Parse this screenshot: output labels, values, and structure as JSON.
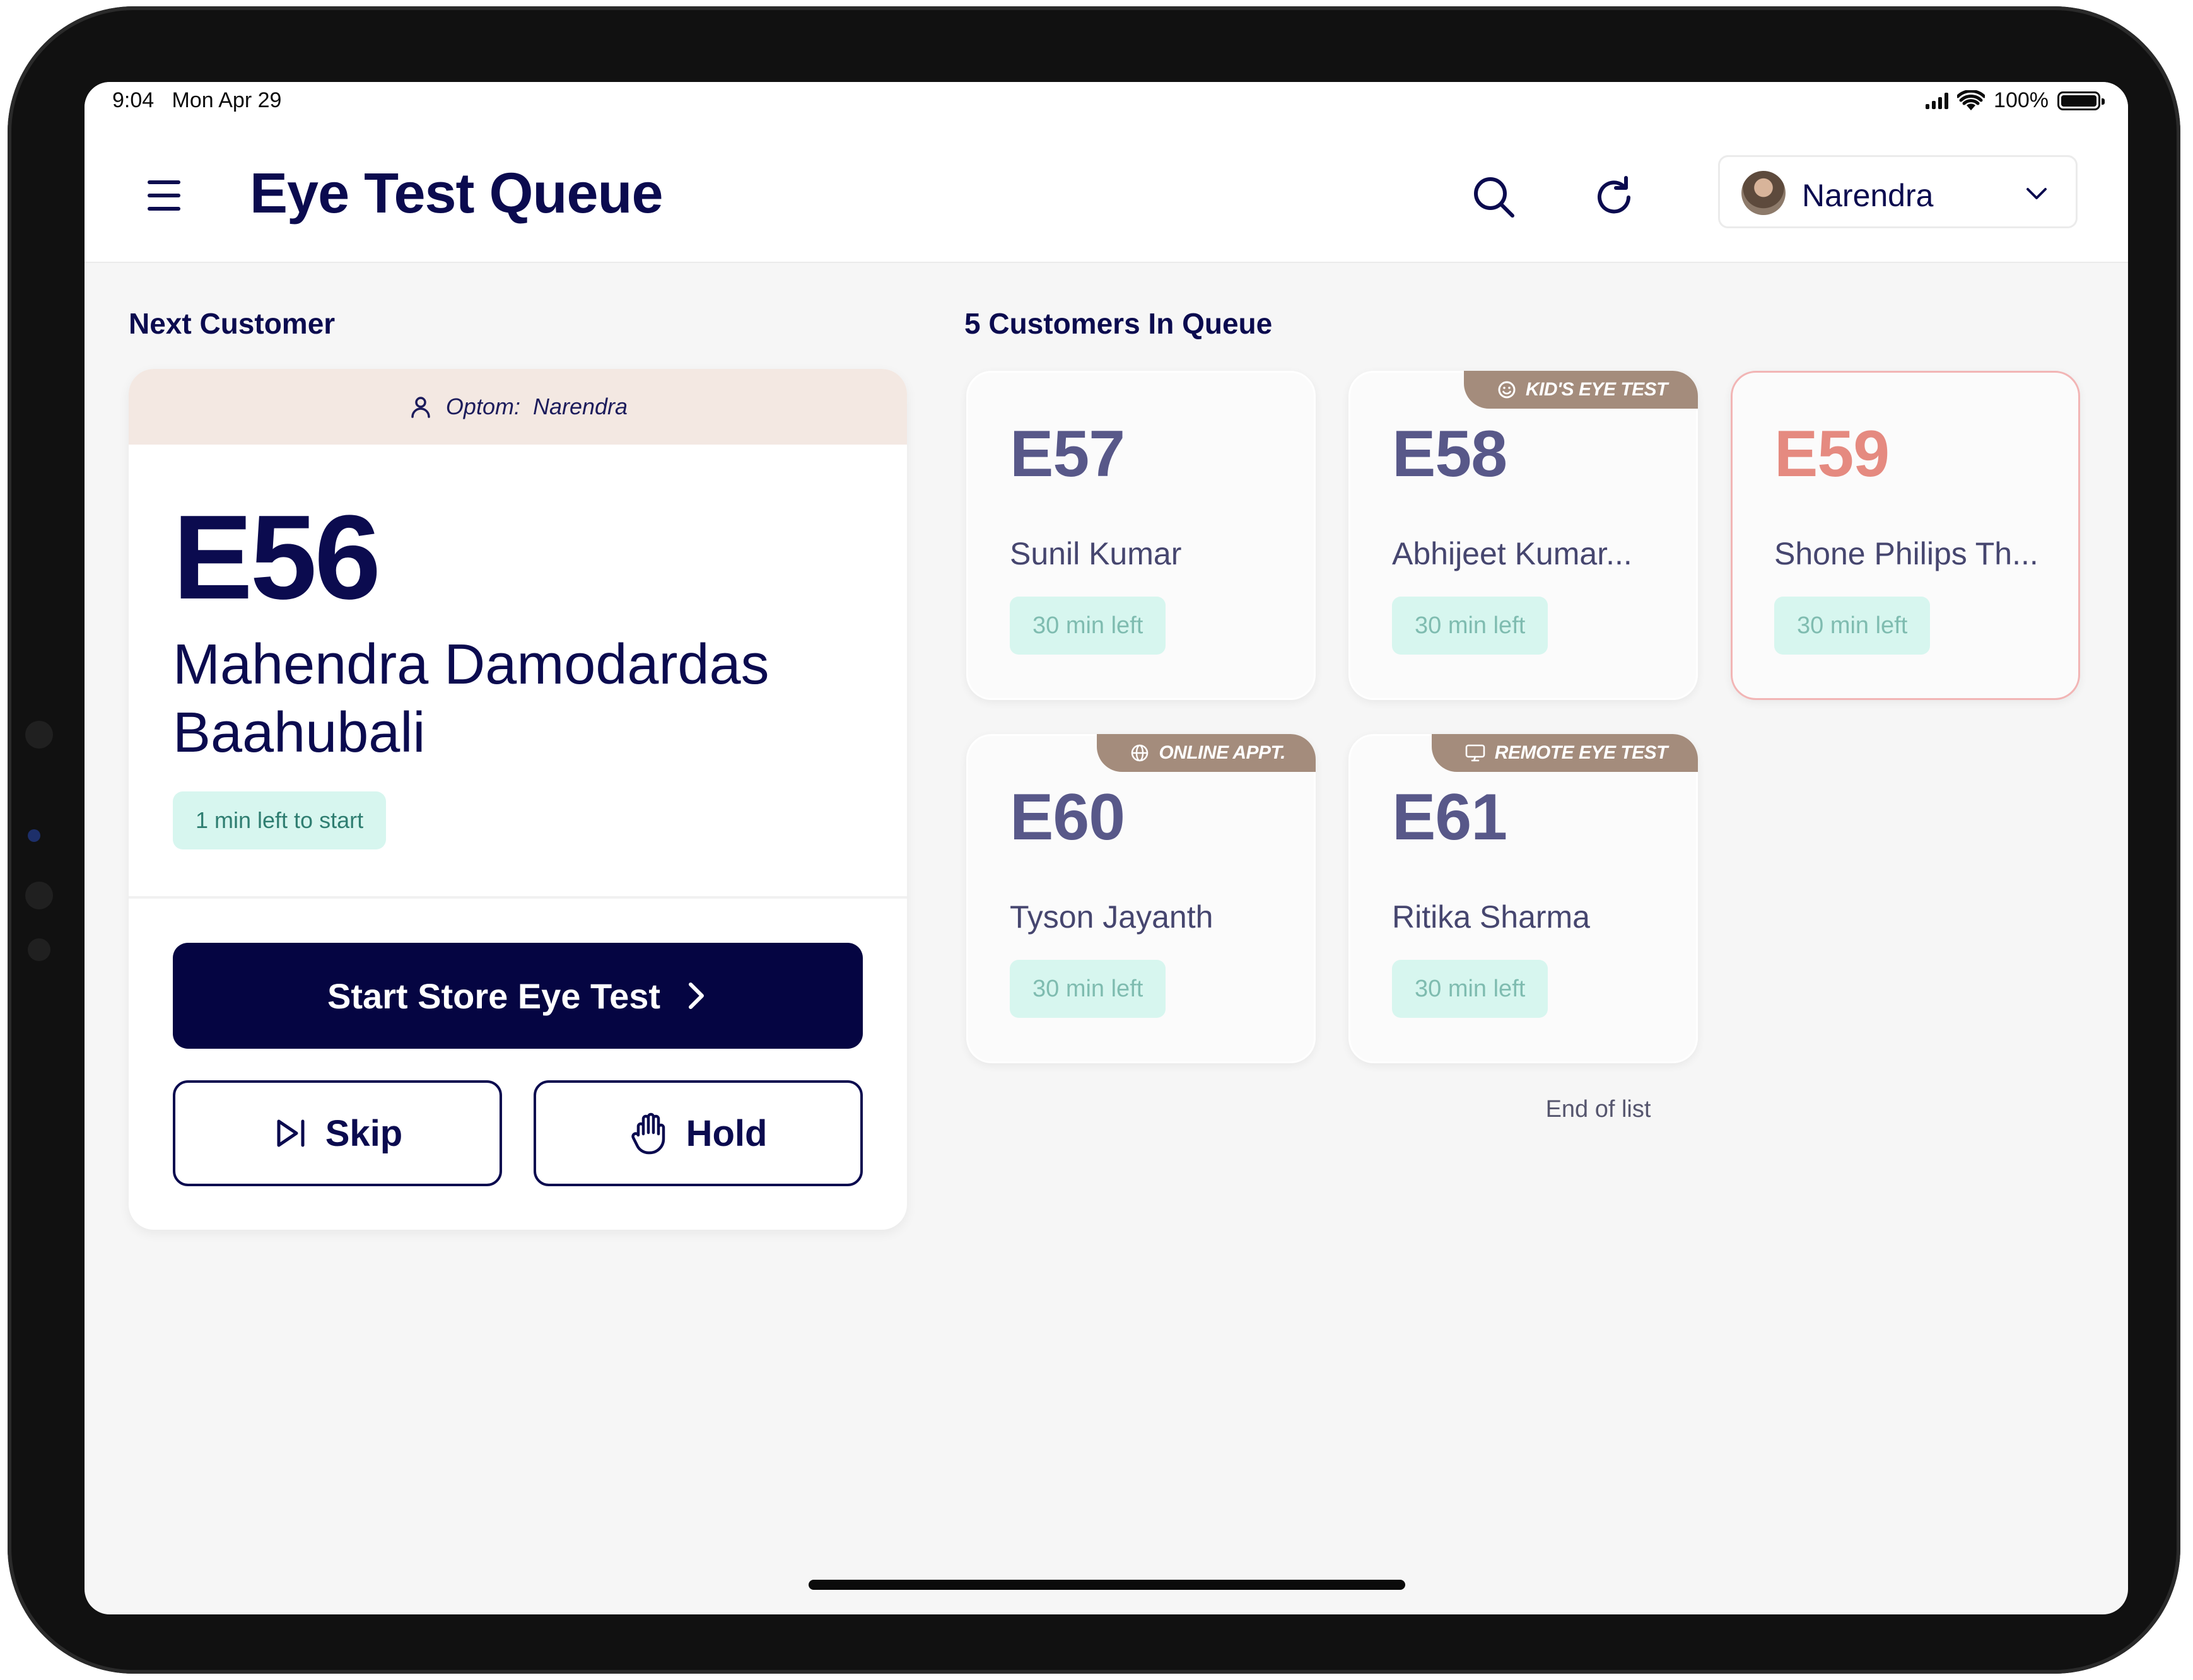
{
  "status_bar": {
    "time": "9:04",
    "date": "Mon Apr 29",
    "battery": "100%"
  },
  "header": {
    "title": "Eye Test Queue",
    "user_name": "Narendra",
    "icons": [
      "menu-icon",
      "search-icon",
      "refresh-icon",
      "chevron-down-icon"
    ]
  },
  "next_customer": {
    "section_title": "Next Customer",
    "optom_label": "Optom:",
    "optom_name": "Narendra",
    "token": "E56",
    "name": "Mahendra Damodardas Baahubali",
    "time_badge": "1 min left to start",
    "start_button": "Start Store Eye Test",
    "skip_button": "Skip",
    "hold_button": "Hold"
  },
  "queue": {
    "section_title": "5 Customers In Queue",
    "end_text": "End of list",
    "items": [
      {
        "token": "E57",
        "name": "Sunil Kumar",
        "time": "30 min left",
        "tag": ""
      },
      {
        "token": "E58",
        "name": "Abhijeet Kumar...",
        "time": "30 min left",
        "tag": "KID'S EYE TEST"
      },
      {
        "token": "E59",
        "name": "Shone Philips Th...",
        "time": "30 min left",
        "tag": ""
      },
      {
        "token": "E60",
        "name": "Tyson Jayanth",
        "time": "30 min left",
        "tag": "ONLINE APPT."
      },
      {
        "token": "E61",
        "name": "Ritika Sharma",
        "time": "30 min left",
        "tag": "REMOTE EYE TEST"
      }
    ]
  },
  "colors": {
    "primary": "#050542",
    "badge_bg": "#d7f6ef",
    "badge_text": "#2f7e71",
    "tag_bg": "#a48c7c",
    "late_token": "#e58a80",
    "late_border": "#f2b5b5",
    "optom_bar_bg": "#f3e8e2"
  }
}
